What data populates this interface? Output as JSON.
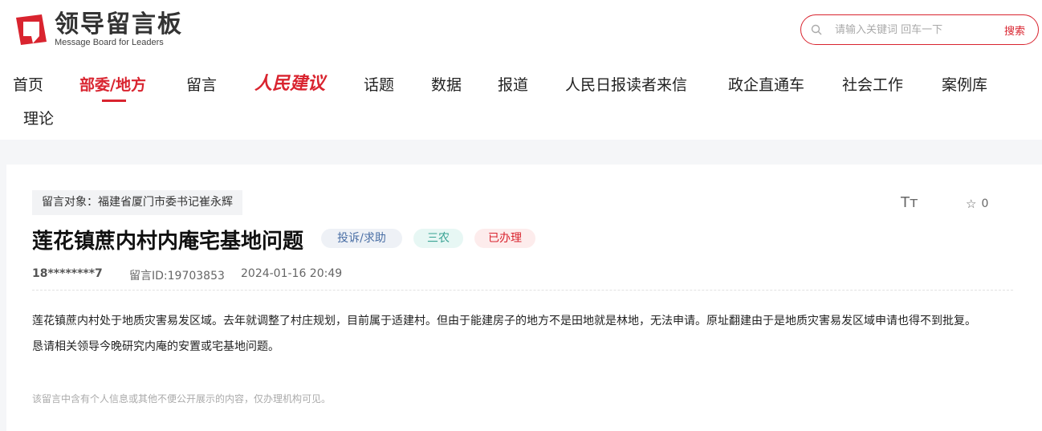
{
  "brand": {
    "name": "领导留言板",
    "subtitle": "Message Board for Leaders",
    "accent_color": "#d9242f"
  },
  "search": {
    "placeholder": "请输入关键词 回车一下",
    "button_label": "搜索",
    "icon": "search-icon"
  },
  "nav": {
    "items": [
      {
        "label": "首页"
      },
      {
        "label": "部委/地方",
        "active": true
      },
      {
        "label": "留言"
      },
      {
        "label": "人民建议",
        "brand_logo": true
      },
      {
        "label": "话题"
      },
      {
        "label": "数据"
      },
      {
        "label": "报道"
      },
      {
        "label": "人民日报读者来信"
      },
      {
        "label": "政企直通车"
      },
      {
        "label": "社会工作"
      },
      {
        "label": "案例库"
      },
      {
        "label": "理论"
      }
    ]
  },
  "message": {
    "target": "留言对象：福建省厦门市委书记崔永辉",
    "title": "莲花镇蔗内村内庵宅基地问题",
    "tags": {
      "type": "投诉/求助",
      "field": "三农",
      "status": "已办理"
    },
    "font_size_icon": "Tт",
    "favorite_count": "0",
    "author": "18********7",
    "message_id": "留言ID:19703853",
    "time": "2024-01-16 20:49",
    "body": {
      "paragraph1": "莲花镇蔗内村处于地质灾害易发区域。去年就调整了村庄规划，目前属于适建村。但由于能建房子的地方不是田地就是林地，无法申请。原址翻建由于是地质灾害易发区域申请也得不到批复。",
      "paragraph2": "恳请相关领导今晚研究内庵的安置或宅基地问题。"
    },
    "privacy_notice": "该留言中含有个人信息或其他不便公开展示的内容，仅办理机构可见。"
  }
}
